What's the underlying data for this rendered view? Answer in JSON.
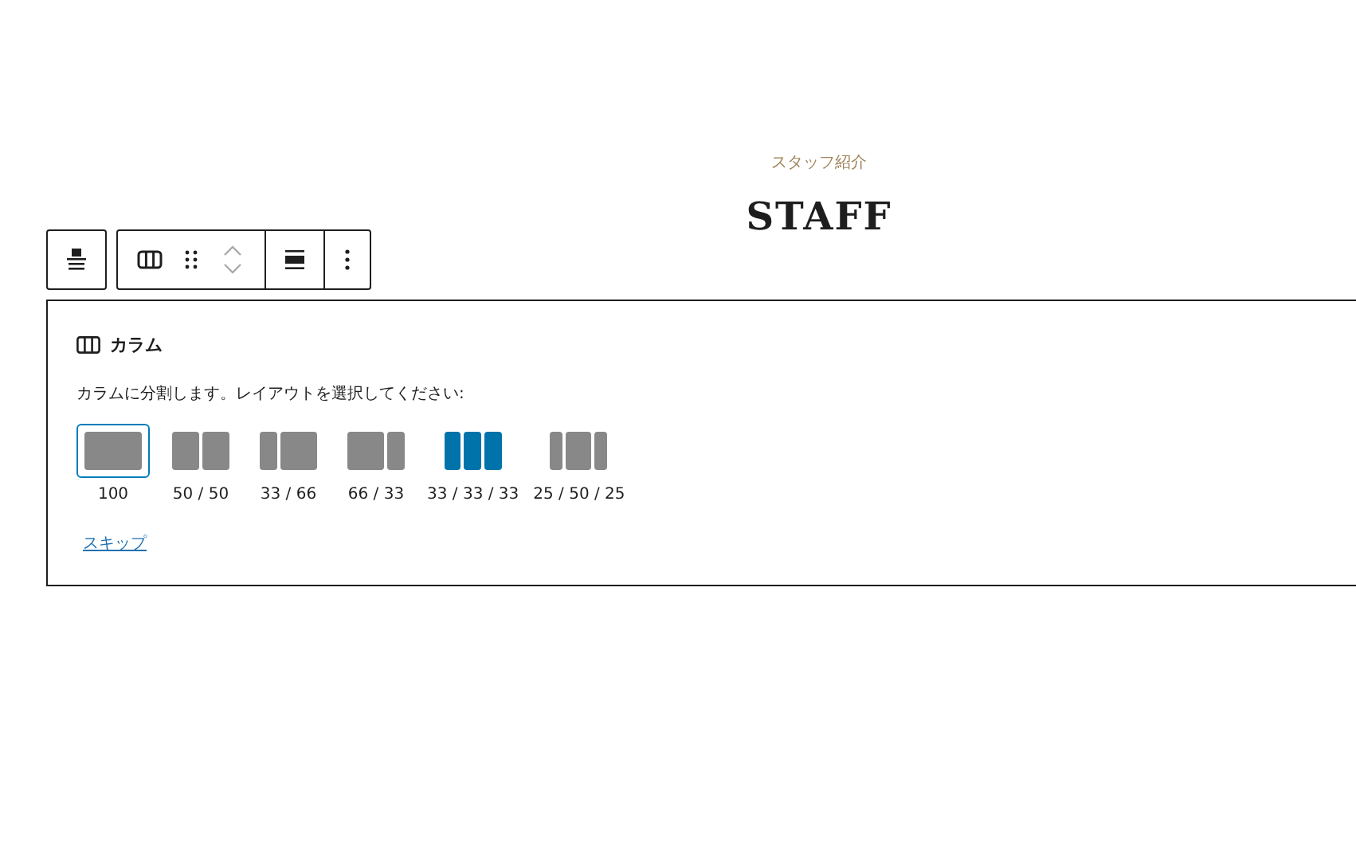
{
  "heading": {
    "subtitle": "スタッフ紹介",
    "title": "STAFF"
  },
  "panel": {
    "title": "カラム",
    "instructions": "カラムに分割します。レイアウトを選択してください:",
    "options": [
      {
        "kind": "full",
        "label": "100",
        "selected": true,
        "hovered": false
      },
      {
        "kind": "halves",
        "label": "50 / 50",
        "selected": false,
        "hovered": false
      },
      {
        "kind": "narrowwide",
        "label": "33 / 66",
        "selected": false,
        "hovered": false
      },
      {
        "kind": "widenarrow",
        "label": "66 / 33",
        "selected": false,
        "hovered": false
      },
      {
        "kind": "thirds",
        "label": "33 / 33 / 33",
        "selected": false,
        "hovered": true
      },
      {
        "kind": "centerwide",
        "label": "25 / 50 / 25",
        "selected": false,
        "hovered": false
      }
    ],
    "skip": "スキップ"
  }
}
